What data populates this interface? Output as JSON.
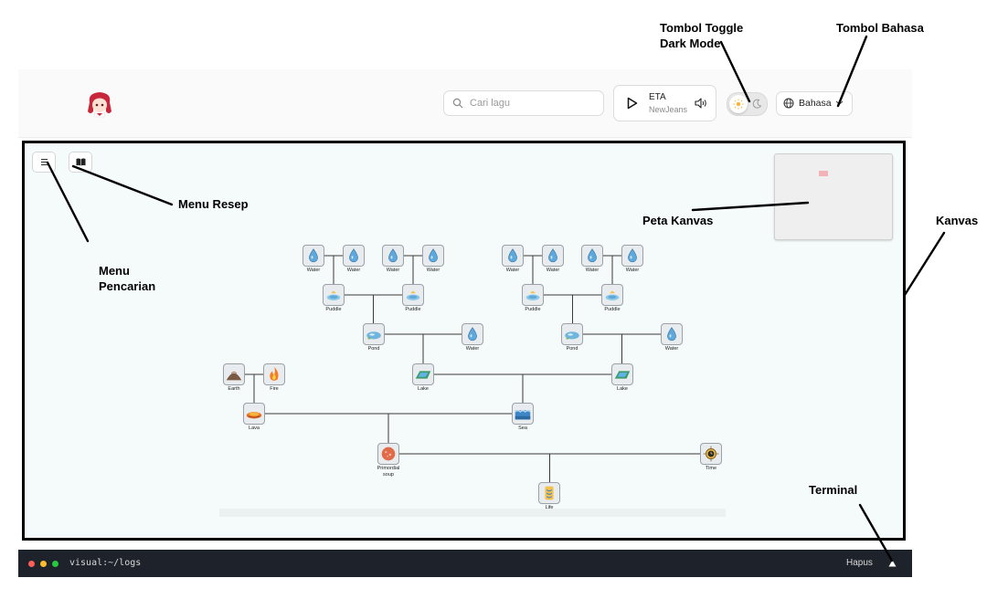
{
  "annotations": {
    "dark_mode_toggle": "Tombol Toggle\nDark Mode",
    "language_button": "Tombol Bahasa",
    "recipe_menu": "Menu Resep",
    "search_menu": "Menu\nPencarian",
    "canvas_map": "Peta Kanvas",
    "canvas": "Kanvas",
    "terminal": "Terminal"
  },
  "header": {
    "search_placeholder": "Cari lagu",
    "now_playing": {
      "title": "ETA",
      "artist": "NewJeans"
    },
    "language_label": "Bahasa"
  },
  "terminal": {
    "path": "visual:~/logs",
    "clear_label": "Hapus"
  },
  "colors": {
    "terminal_bg": "#1e232b",
    "canvas_bg": "#f5fafa",
    "dot_red": "#ff5f57",
    "dot_yellow": "#febc2e",
    "dot_green": "#28c840"
  },
  "tree_nodes": [
    {
      "id": "w1",
      "label": "Water",
      "icon": "water-drop"
    },
    {
      "id": "w2",
      "label": "Water",
      "icon": "water-drop"
    },
    {
      "id": "w3",
      "label": "Water",
      "icon": "water-drop"
    },
    {
      "id": "w4",
      "label": "Water",
      "icon": "water-drop"
    },
    {
      "id": "w5",
      "label": "Water",
      "icon": "water-drop"
    },
    {
      "id": "w6",
      "label": "Water",
      "icon": "water-drop"
    },
    {
      "id": "w7",
      "label": "Water",
      "icon": "water-drop"
    },
    {
      "id": "w8",
      "label": "Water",
      "icon": "water-drop"
    },
    {
      "id": "pu1",
      "label": "Puddle",
      "icon": "puddle"
    },
    {
      "id": "pu2",
      "label": "Puddle",
      "icon": "puddle"
    },
    {
      "id": "pu3",
      "label": "Puddle",
      "icon": "puddle"
    },
    {
      "id": "pu4",
      "label": "Puddle",
      "icon": "puddle"
    },
    {
      "id": "po1",
      "label": "Pond",
      "icon": "pond"
    },
    {
      "id": "w9",
      "label": "Water",
      "icon": "water-drop"
    },
    {
      "id": "po2",
      "label": "Pond",
      "icon": "pond"
    },
    {
      "id": "w10",
      "label": "Water",
      "icon": "water-drop"
    },
    {
      "id": "la1",
      "label": "Lake",
      "icon": "lake"
    },
    {
      "id": "la2",
      "label": "Lake",
      "icon": "lake"
    },
    {
      "id": "earth",
      "label": "Earth",
      "icon": "earth"
    },
    {
      "id": "fire",
      "label": "Fire",
      "icon": "fire"
    },
    {
      "id": "lava",
      "label": "Lava",
      "icon": "lava"
    },
    {
      "id": "sea",
      "label": "Sea",
      "icon": "sea"
    },
    {
      "id": "soup",
      "label": "Primordial\nsoup",
      "icon": "primordial-soup"
    },
    {
      "id": "time",
      "label": "Time",
      "icon": "time"
    },
    {
      "id": "life",
      "label": "Life",
      "icon": "life"
    }
  ]
}
